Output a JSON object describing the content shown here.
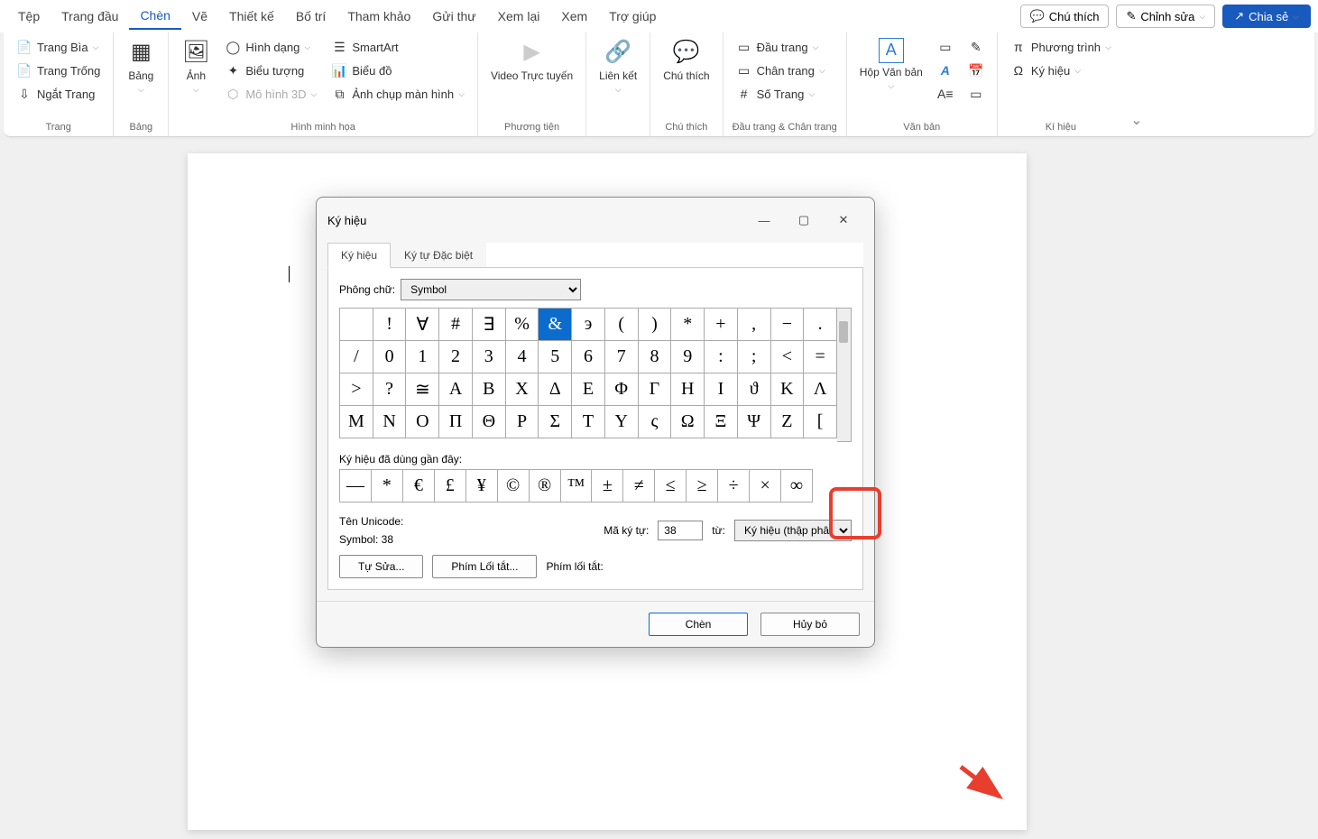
{
  "tabs": [
    "Tệp",
    "Trang đầu",
    "Chèn",
    "Vẽ",
    "Thiết kế",
    "Bố trí",
    "Tham khảo",
    "Gửi thư",
    "Xem lại",
    "Xem",
    "Trợ giúp"
  ],
  "active_tab": 2,
  "top_right": {
    "comment": "Chú thích",
    "edit": "Chỉnh sửa",
    "share": "Chia sẻ"
  },
  "ribbon": {
    "g1": {
      "label": "Trang",
      "items": [
        "Trang Bìa",
        "Trang Trống",
        "Ngắt Trang"
      ]
    },
    "g2": {
      "label": "Bảng",
      "big": "Bảng"
    },
    "g3": {
      "label": "Hình minh họa",
      "big": "Ảnh",
      "items": [
        "Hình dạng",
        "Biểu tượng",
        "Mô hình 3D",
        "SmartArt",
        "Biểu đồ",
        "Ảnh chụp màn hình"
      ]
    },
    "g4": {
      "label": "Phương tiện",
      "big": "Video Trực tuyến"
    },
    "g5": {
      "label": "",
      "big": "Liên kết"
    },
    "g6": {
      "label": "Chú thích",
      "big": "Chú thích"
    },
    "g7": {
      "label": "Đầu trang & Chân trang",
      "items": [
        "Đầu trang",
        "Chân trang",
        "Số Trang"
      ]
    },
    "g8": {
      "label": "Văn bản",
      "big": "Hộp Văn bản"
    },
    "g9": {
      "label": "Kí hiệu",
      "items": [
        "Phương trình",
        "Ký hiệu"
      ]
    }
  },
  "dialog": {
    "title": "Ký hiệu",
    "tab1": "Ký hiệu",
    "tab2": "Ký tự Đặc biệt",
    "font_label": "Phông chữ:",
    "font_value": "Symbol",
    "grid": [
      [
        "",
        "!",
        "∀",
        "#",
        "∃",
        "%",
        "&",
        "э",
        "(",
        ")",
        "*",
        "+",
        ",",
        "−",
        "."
      ],
      [
        "/",
        "0",
        "1",
        "2",
        "3",
        "4",
        "5",
        "6",
        "7",
        "8",
        "9",
        ":",
        ";",
        "<",
        "="
      ],
      [
        ">",
        "?",
        "≅",
        "Α",
        "Β",
        "Χ",
        "Δ",
        "Ε",
        "Φ",
        "Γ",
        "Η",
        "Ι",
        "ϑ",
        "Κ",
        "Λ"
      ],
      [
        "Μ",
        "Ν",
        "Ο",
        "Π",
        "Θ",
        "Ρ",
        "Σ",
        "Τ",
        "Υ",
        "ς",
        "Ω",
        "Ξ",
        "Ψ",
        "Ζ",
        "["
      ]
    ],
    "selected_row": 0,
    "selected_col": 6,
    "recent_label": "Ký hiệu đã dùng gần đây:",
    "recent": [
      "—",
      "*",
      "€",
      "£",
      "¥",
      "©",
      "®",
      "™",
      "±",
      "≠",
      "≤",
      "≥",
      "÷",
      "×",
      "∞"
    ],
    "unicode_label": "Tên Unicode:",
    "symbol_name": "Symbol: 38",
    "code_label": "Mã ký tự:",
    "code_value": "38",
    "from_label": "từ:",
    "from_value": "Ký hiệu (thập phân)",
    "autocorrect": "Tự Sửa...",
    "shortcut": "Phím Lối tắt...",
    "shortcut_label": "Phím lối tắt:",
    "insert": "Chèn",
    "cancel": "Hủy bỏ"
  }
}
